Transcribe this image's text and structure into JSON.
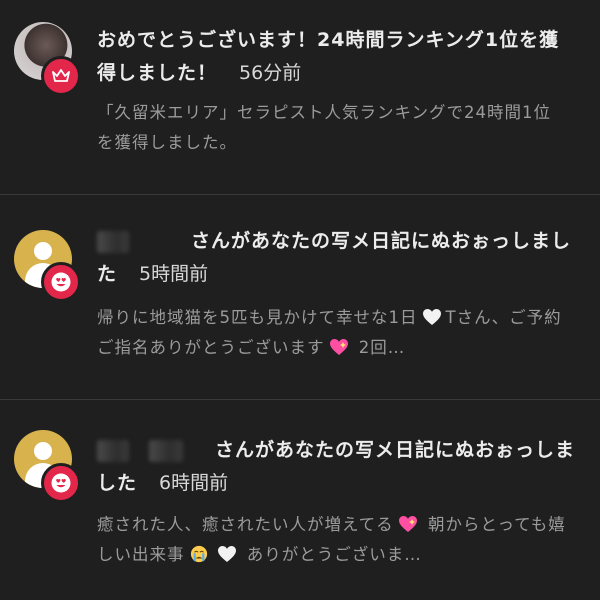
{
  "notifications": [
    {
      "title": "おめでとうございます！24時間ランキング1位を獲得しました！",
      "time": "56分前",
      "body": "「久留米エリア」セラピスト人気ランキングで24時間1位を獲得しました。",
      "badge_icon": "crown-icon",
      "badge_color": "#e2274b"
    },
    {
      "title_suffix": "さんがあなたの写メ日記にぬおぉっしました",
      "time": "5時間前",
      "body_part1": "帰りに地域猫を5匹も見かけて幸せな1日",
      "body_part2": "Tさん、ご予約ご指名ありがとうございます",
      "body_part3": "2回…",
      "badge_icon": "heart-eyes-icon",
      "badge_color": "#e2274b",
      "avatar_color": "#d7b24d"
    },
    {
      "title_suffix": "さんがあなたの写メ日記にぬおぉっしました",
      "time": "6時間前",
      "body_part1": "癒された人、癒されたい人が増えてる",
      "body_part2": "朝からとっても嬉しい出来事",
      "body_part3": "ありがとうございま…",
      "badge_icon": "heart-eyes-icon",
      "badge_color": "#e2274b",
      "avatar_color": "#d7b24d"
    }
  ]
}
